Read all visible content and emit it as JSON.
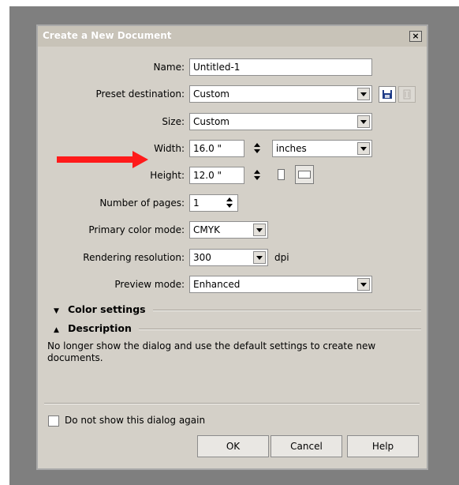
{
  "dialog": {
    "title": "Create a New Document",
    "close_symbol": "×"
  },
  "form": {
    "name": {
      "label": "Name:",
      "value": "Untitled-1"
    },
    "preset": {
      "label": "Preset destination:",
      "value": "Custom"
    },
    "size": {
      "label": "Size:",
      "value": "Custom"
    },
    "width": {
      "label": "Width:",
      "value": "16.0 \"",
      "unit": "inches"
    },
    "height": {
      "label": "Height:",
      "value": "12.0 \""
    },
    "pages": {
      "label": "Number of pages:",
      "value": "1"
    },
    "color_mode": {
      "label": "Primary color mode:",
      "value": "CMYK"
    },
    "resolution": {
      "label": "Rendering resolution:",
      "value": "300",
      "unit": "dpi"
    },
    "preview": {
      "label": "Preview mode:",
      "value": "Enhanced"
    }
  },
  "sections": {
    "color_settings": "Color settings",
    "description": "Description",
    "description_text": "No longer show the dialog and use the default settings to create new documents."
  },
  "footer": {
    "dont_show": "Do not show this dialog again",
    "ok": "OK",
    "cancel": "Cancel",
    "help": "Help"
  },
  "colors": {
    "arrow": "#ff1a1a",
    "dialog_bg": "#d4d0c8",
    "backdrop": "#7f7f7f",
    "save_icon": "#1f3c88"
  },
  "icons": [
    "close-icon",
    "save-preset-icon",
    "delete-preset-icon",
    "portrait-orientation-icon",
    "landscape-orientation-icon",
    "red-arrow"
  ]
}
